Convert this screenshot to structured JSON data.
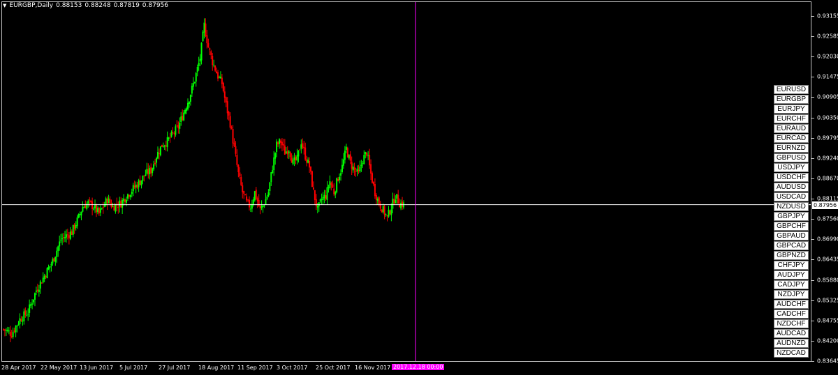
{
  "header": {
    "symbol": "EURGBP,Daily",
    "open": "0.88153",
    "high": "0.88248",
    "low": "0.87819",
    "close": "0.87956"
  },
  "price_axis": {
    "labels": [
      "0.93155",
      "0.92585",
      "0.92030",
      "0.91475",
      "0.90905",
      "0.90350",
      "0.89795",
      "0.89240",
      "0.88670",
      "0.88115",
      "0.87560",
      "0.86990",
      "0.86435",
      "0.85880",
      "0.85325",
      "0.84755",
      "0.84200",
      "0.83645"
    ],
    "bid_price": "0.87956"
  },
  "time_axis": {
    "labels": [
      "28 Apr 2017",
      "22 May 2017",
      "13 Jun 2017",
      "5 Jul 2017",
      "27 Jul 2017",
      "18 Aug 2017",
      "11 Sep 2017",
      "3 Oct 2017",
      "25 Oct 2017",
      "16 Nov 2017"
    ],
    "cursor_date": "2017.12.18 00:00"
  },
  "symbols": [
    "EURUSD",
    "EURGBP",
    "EURJPY",
    "EURCHF",
    "EURAUD",
    "EURCAD",
    "EURNZD",
    "GBPUSD",
    "USDJPY",
    "USDCHF",
    "AUDUSD",
    "USDCAD",
    "NZDUSD",
    "GBPJPY",
    "GBPCHF",
    "GBPAUD",
    "GBPCAD",
    "GBPNZD",
    "CHFJPY",
    "AUDJPY",
    "CADJPY",
    "NZDJPY",
    "AUDCHF",
    "CADCHF",
    "NZDCHF",
    "AUDCAD",
    "AUDNZD",
    "NZDCAD"
  ],
  "colors": {
    "background": "#000000",
    "bull": "#00ff00",
    "bear": "#ff0000",
    "crosshair": "#ffffff",
    "cursor_line": "#ff00ff"
  },
  "chart_data": {
    "type": "candlestick",
    "title": "EURGBP,Daily",
    "ylim": [
      0.83645,
      0.93155
    ],
    "x_range": [
      "2017-04-28",
      "2017-12-18"
    ],
    "crosshair_price": 0.87956,
    "path_close": [
      [
        0,
        0.8452
      ],
      [
        6,
        0.844
      ],
      [
        12,
        0.848
      ],
      [
        18,
        0.85
      ],
      [
        24,
        0.856
      ],
      [
        30,
        0.86
      ],
      [
        36,
        0.864
      ],
      [
        42,
        0.87
      ],
      [
        50,
        0.872
      ],
      [
        55,
        0.876
      ],
      [
        58,
        0.879
      ],
      [
        62,
        0.88
      ],
      [
        66,
        0.879
      ],
      [
        70,
        0.877
      ],
      [
        76,
        0.881
      ],
      [
        80,
        0.879
      ],
      [
        86,
        0.88
      ],
      [
        90,
        0.882
      ],
      [
        95,
        0.884
      ],
      [
        100,
        0.886
      ],
      [
        104,
        0.888
      ],
      [
        108,
        0.889
      ],
      [
        112,
        0.893
      ],
      [
        116,
        0.896
      ],
      [
        120,
        0.897
      ],
      [
        124,
        0.899
      ],
      [
        128,
        0.901
      ],
      [
        132,
        0.905
      ],
      [
        136,
        0.909
      ],
      [
        140,
        0.914
      ],
      [
        144,
        0.92
      ],
      [
        147,
        0.929
      ],
      [
        150,
        0.923
      ],
      [
        153,
        0.919
      ],
      [
        157,
        0.915
      ],
      [
        160,
        0.913
      ],
      [
        163,
        0.907
      ],
      [
        166,
        0.902
      ],
      [
        169,
        0.895
      ],
      [
        172,
        0.888
      ],
      [
        175,
        0.883
      ],
      [
        178,
        0.88
      ],
      [
        181,
        0.879
      ],
      [
        184,
        0.883
      ],
      [
        188,
        0.878
      ],
      [
        191,
        0.88
      ],
      [
        194,
        0.883
      ],
      [
        197,
        0.89
      ],
      [
        200,
        0.896
      ],
      [
        203,
        0.897
      ],
      [
        206,
        0.894
      ],
      [
        209,
        0.895
      ],
      [
        212,
        0.891
      ],
      [
        215,
        0.892
      ],
      [
        218,
        0.897
      ],
      [
        221,
        0.893
      ],
      [
        224,
        0.89
      ],
      [
        227,
        0.883
      ],
      [
        230,
        0.878
      ],
      [
        233,
        0.881
      ],
      [
        236,
        0.882
      ],
      [
        239,
        0.886
      ],
      [
        242,
        0.883
      ],
      [
        245,
        0.887
      ],
      [
        248,
        0.89
      ],
      [
        251,
        0.895
      ],
      [
        254,
        0.891
      ],
      [
        257,
        0.889
      ],
      [
        260,
        0.888
      ],
      [
        263,
        0.892
      ],
      [
        266,
        0.894
      ],
      [
        269,
        0.888
      ],
      [
        272,
        0.883
      ],
      [
        275,
        0.88
      ],
      [
        278,
        0.878
      ],
      [
        281,
        0.876
      ],
      [
        284,
        0.879
      ],
      [
        287,
        0.882
      ],
      [
        290,
        0.88
      ],
      [
        293,
        0.8796
      ]
    ]
  }
}
